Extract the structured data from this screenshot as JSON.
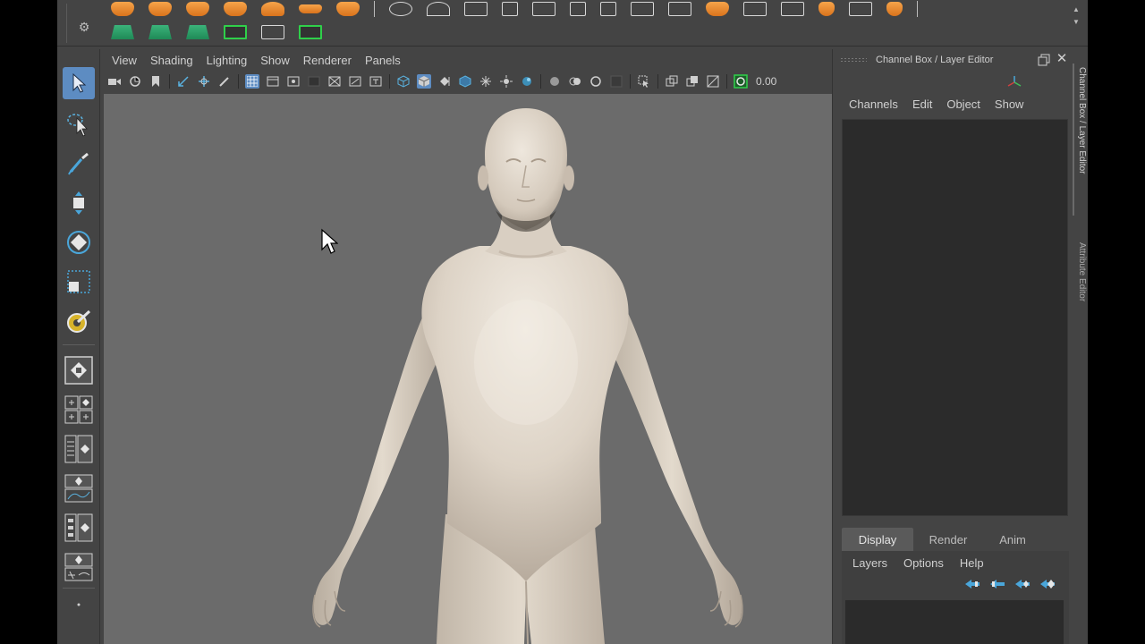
{
  "viewport_menu": [
    "View",
    "Shading",
    "Lighting",
    "Show",
    "Renderer",
    "Panels"
  ],
  "viewport_toolbar": {
    "value": "0.00"
  },
  "channel_box": {
    "title": "Channel Box / Layer Editor",
    "menu": [
      "Channels",
      "Edit",
      "Object",
      "Show"
    ],
    "side_tabs": [
      "Channel Box / Layer Editor",
      "Attribute Editor"
    ]
  },
  "layer_editor": {
    "tabs": [
      "Display",
      "Render",
      "Anim"
    ],
    "active_tab": "Display",
    "menu": [
      "Layers",
      "Options",
      "Help"
    ]
  },
  "colors": {
    "accent": "#5d8cc2",
    "shelf_orange": "#e8882c",
    "shelf_green": "#2ea86a",
    "bracket_green": "#2fd04a",
    "viewport_bg": "#6b6b6b",
    "model_skin": "#ddd3c6"
  },
  "icons": {
    "tools": [
      "select-arrow-icon",
      "lasso-select-icon",
      "paint-select-icon",
      "move-tool-icon",
      "rotate-tool-icon",
      "scale-tool-icon",
      "last-tool-icon"
    ],
    "layouts": [
      "single-perspective-icon",
      "four-view-icon",
      "persp-outliner-icon",
      "persp-graph-icon",
      "persp-hypershade-icon",
      "persp-uv-icon",
      "more-icon"
    ]
  }
}
